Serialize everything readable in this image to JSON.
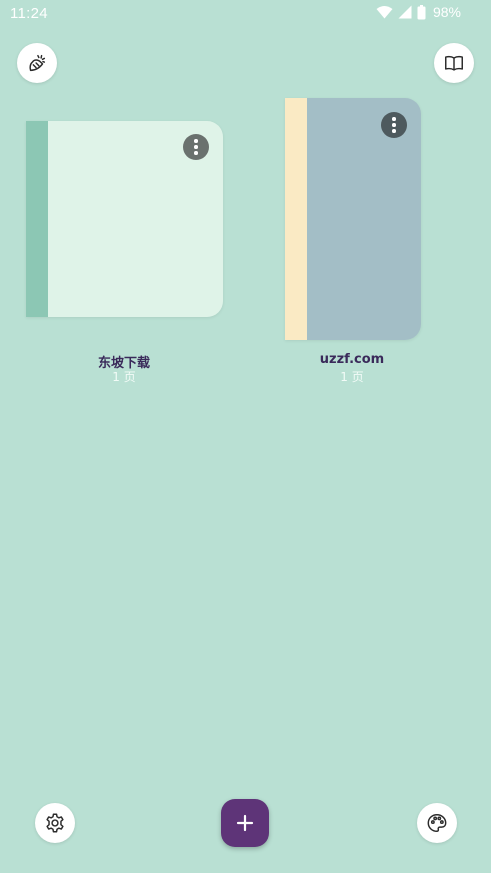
{
  "status_bar": {
    "time": "11:24",
    "battery": "98%"
  },
  "toolbar": {
    "top_left_icon": "clean-brush-icon",
    "top_right_icon": "book-icon"
  },
  "notebooks": [
    {
      "title": "东坡下载",
      "pages": "1 页",
      "spine_color": "#8cc7b4",
      "cover_color": "#dff3e8",
      "menu_color": "#6a716e"
    },
    {
      "title": "uzzf.com",
      "pages": "1 页",
      "spine_color": "#faeac4",
      "cover_color": "#a3bec6",
      "menu_color": "#4e5a5e"
    }
  ],
  "bottom_bar": {
    "settings_icon": "gear-icon",
    "add_icon": "plus-icon",
    "theme_icon": "palette-icon",
    "fab_color": "#5e3478"
  }
}
